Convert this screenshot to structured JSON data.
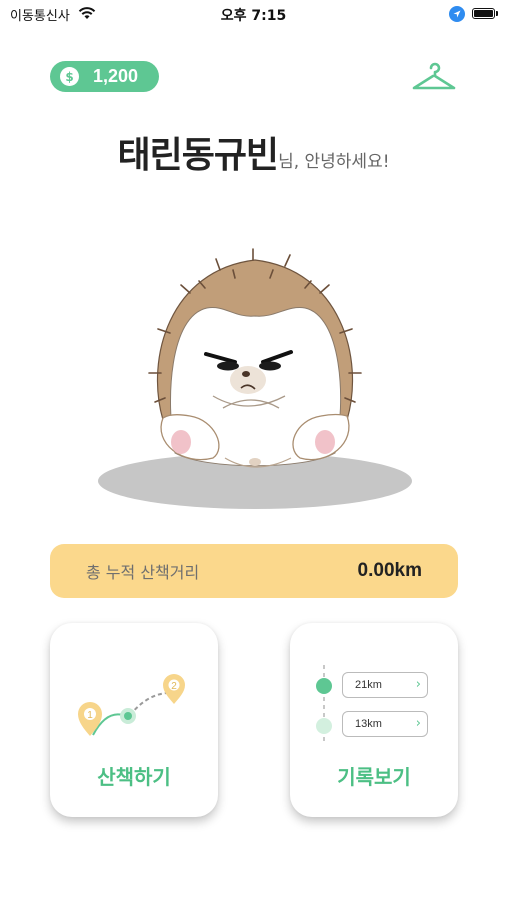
{
  "status_bar": {
    "carrier": "이동통신사",
    "time": "오후 7:15"
  },
  "coin": {
    "symbol": "$",
    "amount": "1,200"
  },
  "greeting": {
    "name": "태린동규빈",
    "suffix": "님, 안녕하세요!"
  },
  "distance": {
    "label": "총 누적 산책거리",
    "value": "0.00km"
  },
  "cards": {
    "walk": {
      "label": "산책하기",
      "pin_1": "1",
      "pin_2": "2"
    },
    "record": {
      "label": "기록보기",
      "rows": [
        {
          "km": "21km"
        },
        {
          "km": "13km"
        }
      ]
    }
  },
  "icons": {
    "status": [
      "wifi-icon",
      "location-icon",
      "battery-icon"
    ],
    "header": [
      "coin-icon",
      "hanger-icon"
    ],
    "chevron": "chevron-right-icon"
  },
  "colors": {
    "accent_green": "#5ec793",
    "label_green": "#4cbf84",
    "distance_bar": "#fbd88c",
    "pin_yellow": "#f7d58a"
  }
}
